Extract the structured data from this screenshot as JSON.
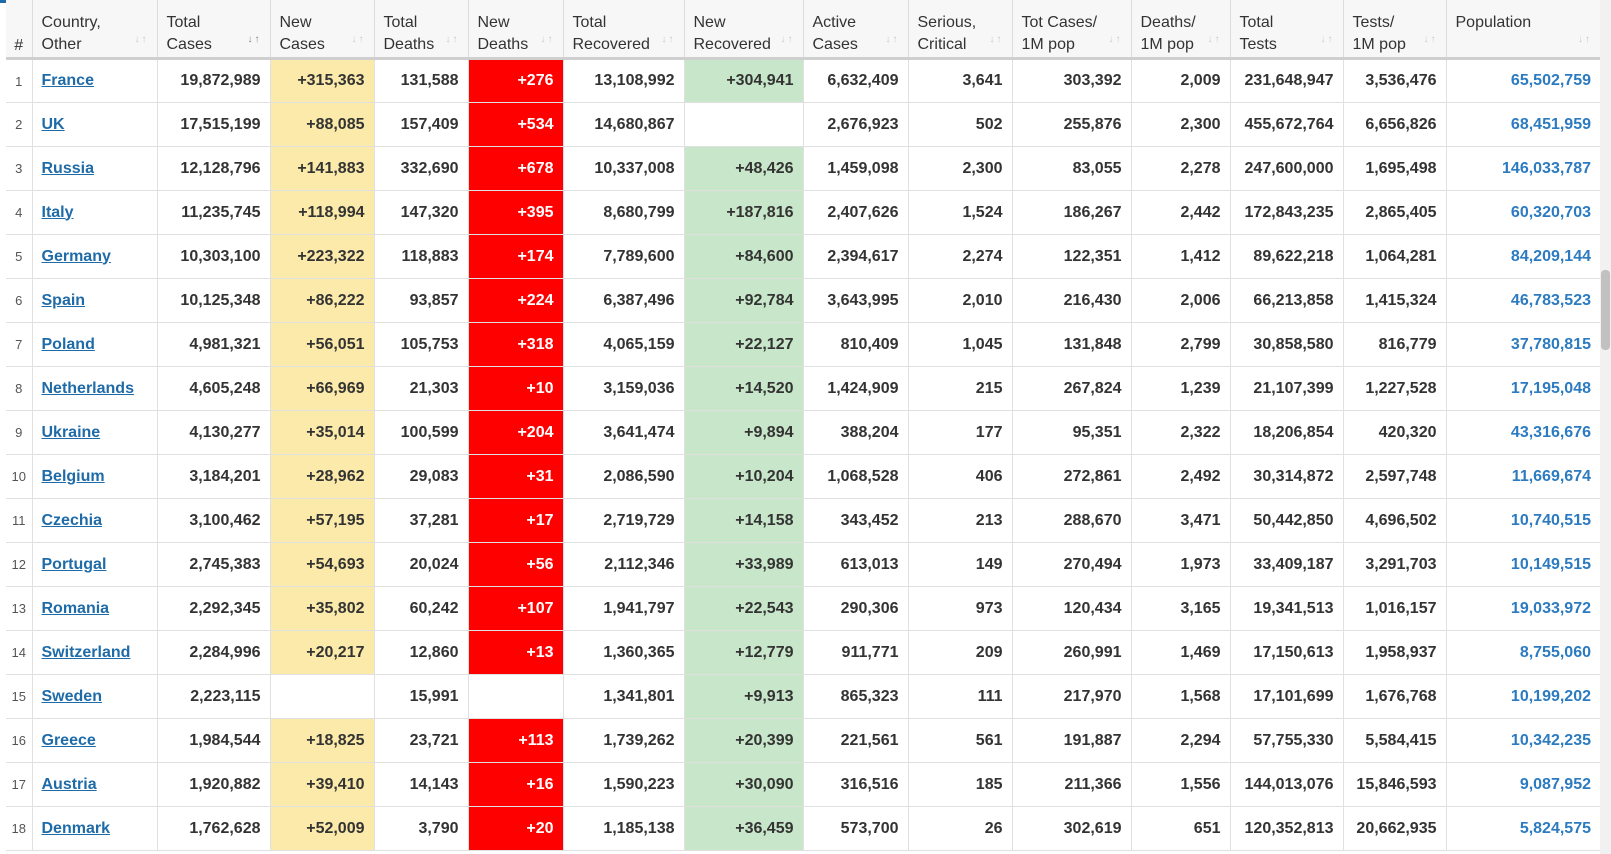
{
  "table": {
    "headers": [
      {
        "key": "idx",
        "label": [
          "#"
        ]
      },
      {
        "key": "country",
        "label": [
          "Country,",
          "Other"
        ]
      },
      {
        "key": "total_cases",
        "label": [
          "Total",
          "Cases"
        ]
      },
      {
        "key": "new_cases",
        "label": [
          "New",
          "Cases"
        ]
      },
      {
        "key": "total_deaths",
        "label": [
          "Total",
          "Deaths"
        ]
      },
      {
        "key": "new_deaths",
        "label": [
          "New",
          "Deaths"
        ]
      },
      {
        "key": "total_recovered",
        "label": [
          "Total",
          "Recovered"
        ]
      },
      {
        "key": "new_recovered",
        "label": [
          "New",
          "Recovered"
        ]
      },
      {
        "key": "active_cases",
        "label": [
          "Active",
          "Cases"
        ]
      },
      {
        "key": "serious",
        "label": [
          "Serious,",
          "Critical"
        ]
      },
      {
        "key": "tot_cases_1m",
        "label": [
          "Tot Cases/",
          "1M pop"
        ]
      },
      {
        "key": "deaths_1m",
        "label": [
          "Deaths/",
          "1M pop"
        ]
      },
      {
        "key": "total_tests",
        "label": [
          "Total",
          "Tests"
        ]
      },
      {
        "key": "tests_1m",
        "label": [
          "Tests/",
          "1M pop"
        ]
      },
      {
        "key": "population",
        "label": [
          "Population"
        ]
      }
    ],
    "active_sort": "total_cases",
    "rows": [
      {
        "idx": "1",
        "country": "France",
        "total_cases": "19,872,989",
        "new_cases": "+315,363",
        "total_deaths": "131,588",
        "new_deaths": "+276",
        "total_recovered": "13,108,992",
        "new_recovered": "+304,941",
        "active_cases": "6,632,409",
        "serious": "3,641",
        "tot_cases_1m": "303,392",
        "deaths_1m": "2,009",
        "total_tests": "231,648,947",
        "tests_1m": "3,536,476",
        "population": "65,502,759"
      },
      {
        "idx": "2",
        "country": "UK",
        "total_cases": "17,515,199",
        "new_cases": "+88,085",
        "total_deaths": "157,409",
        "new_deaths": "+534",
        "total_recovered": "14,680,867",
        "new_recovered": "",
        "active_cases": "2,676,923",
        "serious": "502",
        "tot_cases_1m": "255,876",
        "deaths_1m": "2,300",
        "total_tests": "455,672,764",
        "tests_1m": "6,656,826",
        "population": "68,451,959"
      },
      {
        "idx": "3",
        "country": "Russia",
        "total_cases": "12,128,796",
        "new_cases": "+141,883",
        "total_deaths": "332,690",
        "new_deaths": "+678",
        "total_recovered": "10,337,008",
        "new_recovered": "+48,426",
        "active_cases": "1,459,098",
        "serious": "2,300",
        "tot_cases_1m": "83,055",
        "deaths_1m": "2,278",
        "total_tests": "247,600,000",
        "tests_1m": "1,695,498",
        "population": "146,033,787"
      },
      {
        "idx": "4",
        "country": "Italy",
        "total_cases": "11,235,745",
        "new_cases": "+118,994",
        "total_deaths": "147,320",
        "new_deaths": "+395",
        "total_recovered": "8,680,799",
        "new_recovered": "+187,816",
        "active_cases": "2,407,626",
        "serious": "1,524",
        "tot_cases_1m": "186,267",
        "deaths_1m": "2,442",
        "total_tests": "172,843,235",
        "tests_1m": "2,865,405",
        "population": "60,320,703"
      },
      {
        "idx": "5",
        "country": "Germany",
        "total_cases": "10,303,100",
        "new_cases": "+223,322",
        "total_deaths": "118,883",
        "new_deaths": "+174",
        "total_recovered": "7,789,600",
        "new_recovered": "+84,600",
        "active_cases": "2,394,617",
        "serious": "2,274",
        "tot_cases_1m": "122,351",
        "deaths_1m": "1,412",
        "total_tests": "89,622,218",
        "tests_1m": "1,064,281",
        "population": "84,209,144"
      },
      {
        "idx": "6",
        "country": "Spain",
        "total_cases": "10,125,348",
        "new_cases": "+86,222",
        "total_deaths": "93,857",
        "new_deaths": "+224",
        "total_recovered": "6,387,496",
        "new_recovered": "+92,784",
        "active_cases": "3,643,995",
        "serious": "2,010",
        "tot_cases_1m": "216,430",
        "deaths_1m": "2,006",
        "total_tests": "66,213,858",
        "tests_1m": "1,415,324",
        "population": "46,783,523"
      },
      {
        "idx": "7",
        "country": "Poland",
        "total_cases": "4,981,321",
        "new_cases": "+56,051",
        "total_deaths": "105,753",
        "new_deaths": "+318",
        "total_recovered": "4,065,159",
        "new_recovered": "+22,127",
        "active_cases": "810,409",
        "serious": "1,045",
        "tot_cases_1m": "131,848",
        "deaths_1m": "2,799",
        "total_tests": "30,858,580",
        "tests_1m": "816,779",
        "population": "37,780,815"
      },
      {
        "idx": "8",
        "country": "Netherlands",
        "total_cases": "4,605,248",
        "new_cases": "+66,969",
        "total_deaths": "21,303",
        "new_deaths": "+10",
        "total_recovered": "3,159,036",
        "new_recovered": "+14,520",
        "active_cases": "1,424,909",
        "serious": "215",
        "tot_cases_1m": "267,824",
        "deaths_1m": "1,239",
        "total_tests": "21,107,399",
        "tests_1m": "1,227,528",
        "population": "17,195,048"
      },
      {
        "idx": "9",
        "country": "Ukraine",
        "total_cases": "4,130,277",
        "new_cases": "+35,014",
        "total_deaths": "100,599",
        "new_deaths": "+204",
        "total_recovered": "3,641,474",
        "new_recovered": "+9,894",
        "active_cases": "388,204",
        "serious": "177",
        "tot_cases_1m": "95,351",
        "deaths_1m": "2,322",
        "total_tests": "18,206,854",
        "tests_1m": "420,320",
        "population": "43,316,676"
      },
      {
        "idx": "10",
        "country": "Belgium",
        "total_cases": "3,184,201",
        "new_cases": "+28,962",
        "total_deaths": "29,083",
        "new_deaths": "+31",
        "total_recovered": "2,086,590",
        "new_recovered": "+10,204",
        "active_cases": "1,068,528",
        "serious": "406",
        "tot_cases_1m": "272,861",
        "deaths_1m": "2,492",
        "total_tests": "30,314,872",
        "tests_1m": "2,597,748",
        "population": "11,669,674"
      },
      {
        "idx": "11",
        "country": "Czechia",
        "total_cases": "3,100,462",
        "new_cases": "+57,195",
        "total_deaths": "37,281",
        "new_deaths": "+17",
        "total_recovered": "2,719,729",
        "new_recovered": "+14,158",
        "active_cases": "343,452",
        "serious": "213",
        "tot_cases_1m": "288,670",
        "deaths_1m": "3,471",
        "total_tests": "50,442,850",
        "tests_1m": "4,696,502",
        "population": "10,740,515"
      },
      {
        "idx": "12",
        "country": "Portugal",
        "total_cases": "2,745,383",
        "new_cases": "+54,693",
        "total_deaths": "20,024",
        "new_deaths": "+56",
        "total_recovered": "2,112,346",
        "new_recovered": "+33,989",
        "active_cases": "613,013",
        "serious": "149",
        "tot_cases_1m": "270,494",
        "deaths_1m": "1,973",
        "total_tests": "33,409,187",
        "tests_1m": "3,291,703",
        "population": "10,149,515"
      },
      {
        "idx": "13",
        "country": "Romania",
        "total_cases": "2,292,345",
        "new_cases": "+35,802",
        "total_deaths": "60,242",
        "new_deaths": "+107",
        "total_recovered": "1,941,797",
        "new_recovered": "+22,543",
        "active_cases": "290,306",
        "serious": "973",
        "tot_cases_1m": "120,434",
        "deaths_1m": "3,165",
        "total_tests": "19,341,513",
        "tests_1m": "1,016,157",
        "population": "19,033,972"
      },
      {
        "idx": "14",
        "country": "Switzerland",
        "total_cases": "2,284,996",
        "new_cases": "+20,217",
        "total_deaths": "12,860",
        "new_deaths": "+13",
        "total_recovered": "1,360,365",
        "new_recovered": "+12,779",
        "active_cases": "911,771",
        "serious": "209",
        "tot_cases_1m": "260,991",
        "deaths_1m": "1,469",
        "total_tests": "17,150,613",
        "tests_1m": "1,958,937",
        "population": "8,755,060"
      },
      {
        "idx": "15",
        "country": "Sweden",
        "total_cases": "2,223,115",
        "new_cases": "",
        "total_deaths": "15,991",
        "new_deaths": "",
        "total_recovered": "1,341,801",
        "new_recovered": "+9,913",
        "active_cases": "865,323",
        "serious": "111",
        "tot_cases_1m": "217,970",
        "deaths_1m": "1,568",
        "total_tests": "17,101,699",
        "tests_1m": "1,676,768",
        "population": "10,199,202"
      },
      {
        "idx": "16",
        "country": "Greece",
        "total_cases": "1,984,544",
        "new_cases": "+18,825",
        "total_deaths": "23,721",
        "new_deaths": "+113",
        "total_recovered": "1,739,262",
        "new_recovered": "+20,399",
        "active_cases": "221,561",
        "serious": "561",
        "tot_cases_1m": "191,887",
        "deaths_1m": "2,294",
        "total_tests": "57,755,330",
        "tests_1m": "5,584,415",
        "population": "10,342,235"
      },
      {
        "idx": "17",
        "country": "Austria",
        "total_cases": "1,920,882",
        "new_cases": "+39,410",
        "total_deaths": "14,143",
        "new_deaths": "+16",
        "total_recovered": "1,590,223",
        "new_recovered": "+30,090",
        "active_cases": "316,516",
        "serious": "185",
        "tot_cases_1m": "211,366",
        "deaths_1m": "1,556",
        "total_tests": "144,013,076",
        "tests_1m": "15,846,593",
        "population": "9,087,952"
      },
      {
        "idx": "18",
        "country": "Denmark",
        "total_cases": "1,762,628",
        "new_cases": "+52,009",
        "total_deaths": "3,790",
        "new_deaths": "+20",
        "total_recovered": "1,185,138",
        "new_recovered": "+36,459",
        "active_cases": "573,700",
        "serious": "26",
        "tot_cases_1m": "302,619",
        "deaths_1m": "651",
        "total_tests": "120,352,813",
        "tests_1m": "20,662,935",
        "population": "5,824,575"
      }
    ]
  },
  "colors": {
    "new_cases_bg": "#fbeaaa",
    "new_deaths_bg": "#ff0000",
    "new_recovered_bg": "#c8e6c9",
    "link": "#1f6ba8",
    "population": "#2c7bc0"
  }
}
